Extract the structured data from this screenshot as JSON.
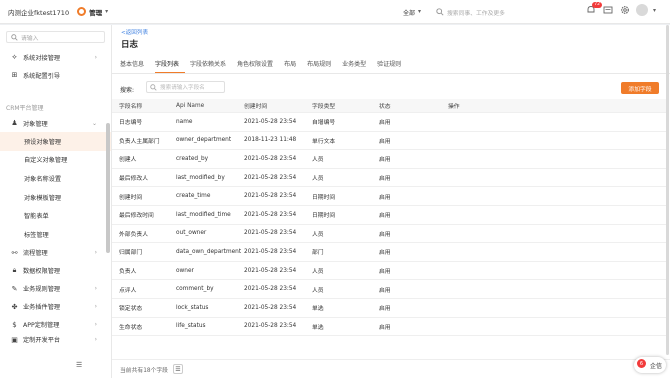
{
  "topbar": {
    "company": "内测企业fktest1710",
    "module": "管理",
    "scope": "全部",
    "search_placeholder": "搜索同事、工作及更多",
    "notification_count": "72"
  },
  "sidebar": {
    "search_placeholder": "请输入",
    "top_items": [
      {
        "label": "系统对接管理",
        "icon": "link-icon"
      },
      {
        "label": "系统配置引导",
        "icon": "grid-icon"
      }
    ],
    "group_label": "CRM平台管理",
    "object_mgmt": "对象管理",
    "sub_items": [
      {
        "label": "预设对象管理",
        "active": true
      },
      {
        "label": "自定义对象管理",
        "active": false
      },
      {
        "label": "对象名称设置",
        "active": false
      },
      {
        "label": "对象模板管理",
        "active": false
      },
      {
        "label": "智能表单",
        "active": false
      },
      {
        "label": "标签管理",
        "active": false
      }
    ],
    "more_items": [
      {
        "label": "流程管理",
        "icon": "flow-icon",
        "arrow": true
      },
      {
        "label": "数据权限管理",
        "icon": "lock-icon",
        "arrow": false
      },
      {
        "label": "业务规则管理",
        "icon": "wrench-icon",
        "arrow": true
      },
      {
        "label": "业务插件管理",
        "icon": "plugin-icon",
        "arrow": true
      },
      {
        "label": "APP定制管理",
        "icon": "app-icon",
        "arrow": true
      },
      {
        "label": "定制开发平台",
        "icon": "dev-icon",
        "arrow": true
      }
    ]
  },
  "main": {
    "back_link": "<返回列表",
    "title": "日志",
    "tabs": [
      {
        "label": "基本信息",
        "active": false
      },
      {
        "label": "字段列表",
        "active": true
      },
      {
        "label": "字段依赖关系",
        "active": false
      },
      {
        "label": "角色权限设置",
        "active": false
      },
      {
        "label": "布局",
        "active": false
      },
      {
        "label": "布局规则",
        "active": false
      },
      {
        "label": "业务类型",
        "active": false
      },
      {
        "label": "验证规则",
        "active": false
      }
    ],
    "search_label": "搜索:",
    "search_placeholder": "搜索请输入字段名",
    "add_button": "添加字段",
    "columns": [
      "字段名称",
      "Api Name",
      "创建时间",
      "字段类型",
      "状态",
      "操作"
    ],
    "rows": [
      [
        "日志编号",
        "name",
        "2021-05-28 23:54",
        "自增编号",
        "启用",
        ""
      ],
      [
        "负责人主属部门",
        "owner_department",
        "2018-11-23 11:48",
        "单行文本",
        "启用",
        ""
      ],
      [
        "创建人",
        "created_by",
        "2021-05-28 23:54",
        "人员",
        "启用",
        ""
      ],
      [
        "最后修改人",
        "last_modified_by",
        "2021-05-28 23:54",
        "人员",
        "启用",
        ""
      ],
      [
        "创建时间",
        "create_time",
        "2021-05-28 23:54",
        "日期时间",
        "启用",
        ""
      ],
      [
        "最后修改时间",
        "last_modified_time",
        "2021-05-28 23:54",
        "日期时间",
        "启用",
        ""
      ],
      [
        "外部负责人",
        "out_owner",
        "2021-05-28 23:54",
        "人员",
        "启用",
        ""
      ],
      [
        "归属部门",
        "data_own_department",
        "2021-05-28 23:54",
        "部门",
        "启用",
        ""
      ],
      [
        "负责人",
        "owner",
        "2021-05-28 23:54",
        "人员",
        "启用",
        ""
      ],
      [
        "点评人",
        "comment_by",
        "2021-05-28 23:54",
        "人员",
        "启用",
        ""
      ],
      [
        "锁定状态",
        "lock_status",
        "2021-05-28 23:54",
        "单选",
        "启用",
        ""
      ],
      [
        "生命状态",
        "life_status",
        "2021-05-28 23:54",
        "单选",
        "启用",
        ""
      ]
    ],
    "footer_text": "当前共有18个字段",
    "float_chip_label": "企信",
    "float_chip_count": "6"
  },
  "colors": {
    "accent": "#f07c2a",
    "link": "#3a7ee0",
    "badge": "#f23b3b"
  }
}
